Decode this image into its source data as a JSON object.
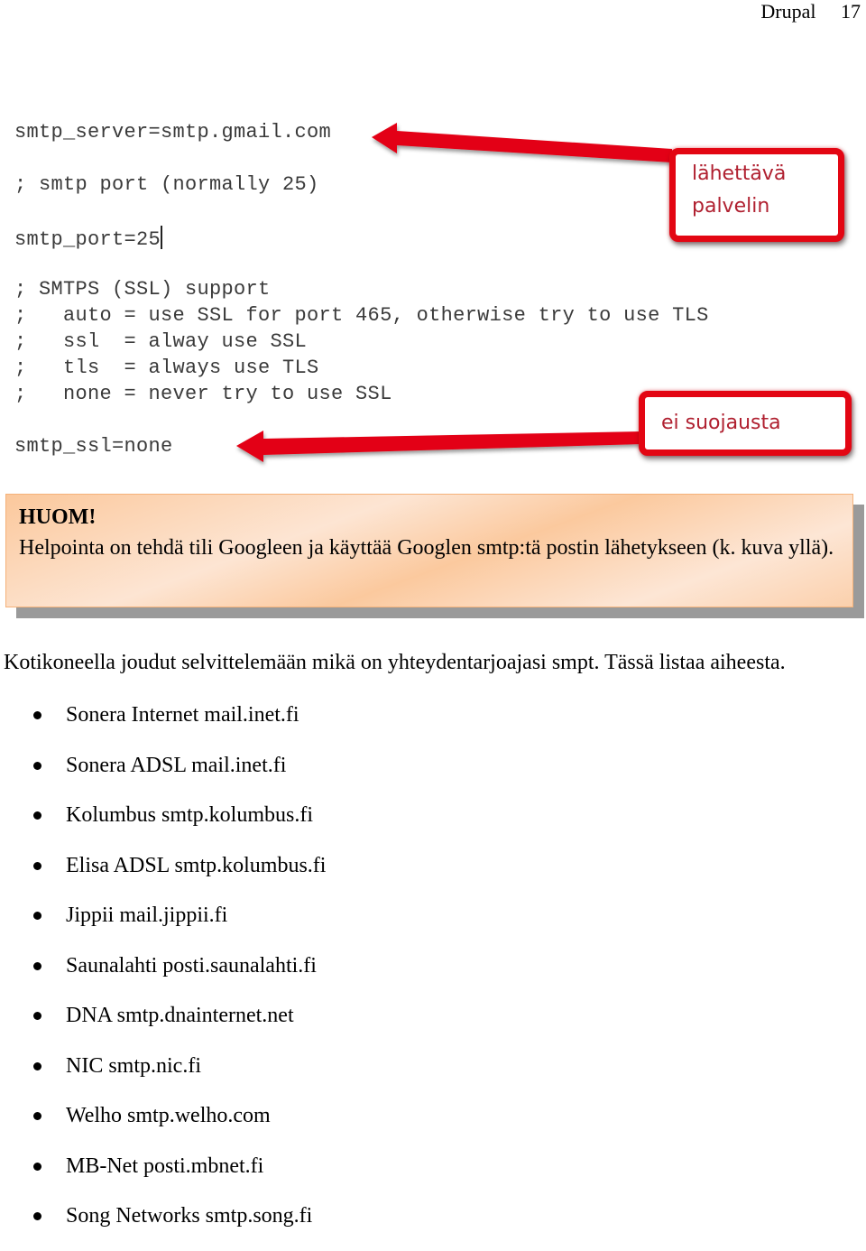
{
  "header": {
    "title": "Drupal",
    "page_number": "17"
  },
  "config_screenshot": {
    "lines": [
      "smtp_server=smtp.gmail.com",
      "; smtp port (normally 25)",
      "smtp_port=25",
      "; SMTPS (SSL) support",
      ";   auto = use SSL for port 465, otherwise try to use TLS",
      ";   ssl  = alway use SSL",
      ";   tls  = always use TLS",
      ";   none = never try to use SSL",
      "smtp_ssl=none"
    ],
    "callouts": [
      {
        "line1": "lähettävä",
        "line2": "palvelin"
      },
      {
        "line1": "ei suojausta"
      }
    ],
    "accent_color": "#e30613"
  },
  "note": {
    "heading": "HUOM!",
    "text": "Helpointa on tehdä tili Googleen ja käyttää Googlen smtp:tä postin lähetykseen (k. kuva yllä)."
  },
  "intro": "Kotikoneella joudut selvittelemään mikä on yhteydentarjoajasi smpt. Tässä listaa aiheesta.",
  "providers": [
    "Sonera Internet mail.inet.fi",
    "Sonera ADSL mail.inet.fi",
    "Kolumbus smtp.kolumbus.fi",
    "Elisa ADSL smtp.kolumbus.fi",
    "Jippii mail.jippii.fi",
    "Saunalahti posti.saunalahti.fi",
    "DNA smtp.dnainternet.net",
    "NIC smtp.nic.fi",
    "Welho smtp.welho.com",
    "MB-Net posti.mbnet.fi",
    "Song Networks smtp.song.fi"
  ]
}
